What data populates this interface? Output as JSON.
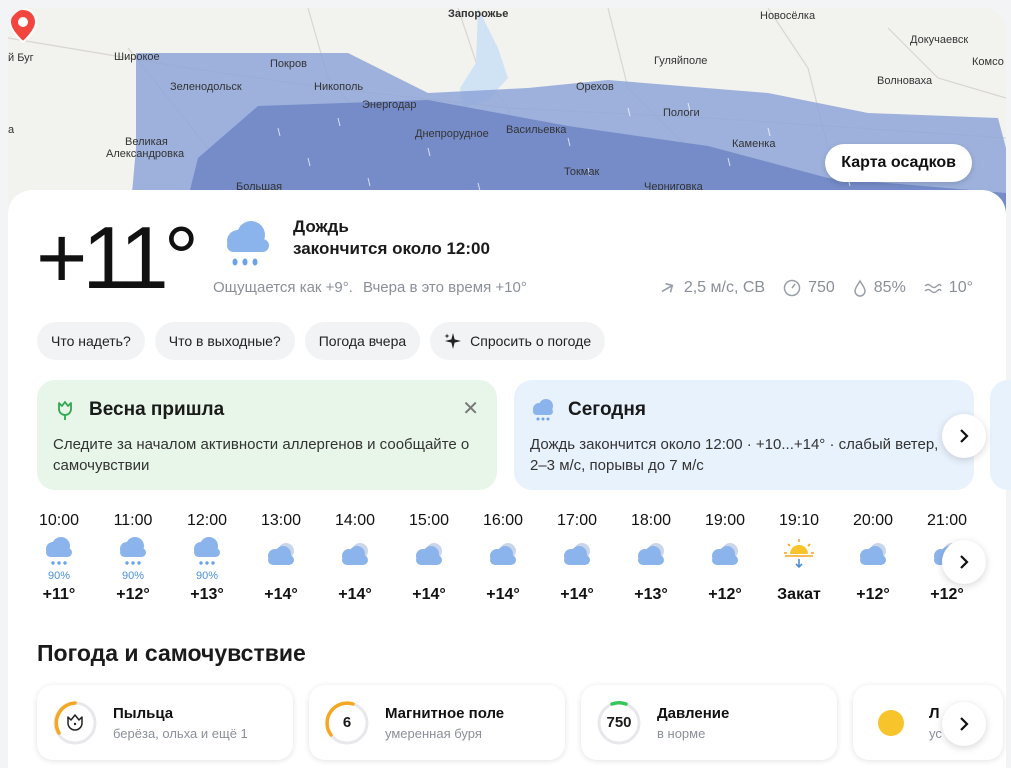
{
  "map": {
    "labels": [
      {
        "id": "zaporozhye",
        "text": "Запорожье"
      },
      {
        "id": "novoselka",
        "text": "Новосёлка"
      },
      {
        "id": "dokuchaevsk",
        "text": "Докучаевск"
      },
      {
        "id": "bug",
        "text": "й Буг"
      },
      {
        "id": "shirokoe",
        "text": "Широкое"
      },
      {
        "id": "pokrov",
        "text": "Покров"
      },
      {
        "id": "gulyaypole",
        "text": "Гуляйполе"
      },
      {
        "id": "komso",
        "text": "Комсо"
      },
      {
        "id": "zelenodolsk",
        "text": "Зеленодольск"
      },
      {
        "id": "nikopol",
        "text": "Никополь"
      },
      {
        "id": "orekhov",
        "text": "Орехов"
      },
      {
        "id": "volnovakha",
        "text": "Волноваха"
      },
      {
        "id": "energodar",
        "text": "Энергодар"
      },
      {
        "id": "pologi",
        "text": "Пологи"
      },
      {
        "id": "dneprorudnoe",
        "text": "Днепрорудное"
      },
      {
        "id": "vasilyevka",
        "text": "Васильевка"
      },
      {
        "id": "velikaya",
        "text": "Великая"
      },
      {
        "id": "aleksandrovka",
        "text": "Александровка"
      },
      {
        "id": "kamenka",
        "text": "Каменка"
      },
      {
        "id": "tokmak",
        "text": "Токмак"
      },
      {
        "id": "bolshaya",
        "text": "Большая"
      },
      {
        "id": "chernigovka",
        "text": "Черниговка"
      },
      {
        "id": "a",
        "text": "а"
      }
    ],
    "precip_button": "Карта осадков"
  },
  "current": {
    "temperature": "+11°",
    "condition": "Дождь",
    "condition_sub": "закончится около 12:00",
    "feels_like": "Ощущается как +9°.",
    "yesterday": "Вчера в это время +10°",
    "wind": "2,5 м/с, СВ",
    "pressure": "750",
    "humidity": "85%",
    "water": "10°"
  },
  "chips": [
    {
      "label": "Что надеть?"
    },
    {
      "label": "Что в выходные?"
    },
    {
      "label": "Погода вчера"
    },
    {
      "label": "Спросить о погоде"
    }
  ],
  "spring_card": {
    "title": "Весна пришла",
    "body": "Следите за началом активности аллергенов и сообщайте о самочувствии",
    "close": "✕"
  },
  "today_card": {
    "title": "Сегодня",
    "body": "Дождь закончится около 12:00 · +10...+14° · слабый ветер, 2–3 м/с, порывы до 7 м/с"
  },
  "hourly": [
    {
      "time": "10:00",
      "icon": "rain",
      "prob": "90%",
      "temp": "+11°"
    },
    {
      "time": "11:00",
      "icon": "rain",
      "prob": "90%",
      "temp": "+12°"
    },
    {
      "time": "12:00",
      "icon": "rain",
      "prob": "90%",
      "temp": "+13°"
    },
    {
      "time": "13:00",
      "icon": "cloudy",
      "prob": "",
      "temp": "+14°"
    },
    {
      "time": "14:00",
      "icon": "cloudy",
      "prob": "",
      "temp": "+14°"
    },
    {
      "time": "15:00",
      "icon": "cloudy",
      "prob": "",
      "temp": "+14°"
    },
    {
      "time": "16:00",
      "icon": "cloudy",
      "prob": "",
      "temp": "+14°"
    },
    {
      "time": "17:00",
      "icon": "cloudy",
      "prob": "",
      "temp": "+14°"
    },
    {
      "time": "18:00",
      "icon": "cloudy",
      "prob": "",
      "temp": "+13°"
    },
    {
      "time": "19:00",
      "icon": "cloudy",
      "prob": "",
      "temp": "+12°"
    },
    {
      "time": "19:10",
      "icon": "sunset",
      "prob": "",
      "temp": "Закат"
    },
    {
      "time": "20:00",
      "icon": "cloudy",
      "prob": "",
      "temp": "+12°"
    },
    {
      "time": "21:00",
      "icon": "cloudy",
      "prob": "",
      "temp": "+12°"
    }
  ],
  "wellbeing": {
    "title": "Погода и самочувствие",
    "tiles": [
      {
        "name": "Пыльца",
        "desc": "берёза, ольха и ещё 1",
        "value": "",
        "color": "#f5a623",
        "icon": "flower-icon"
      },
      {
        "name": "Магнитное поле",
        "desc": "умеренная буря",
        "value": "6",
        "color": "#f5a623",
        "icon": "magnet-gauge"
      },
      {
        "name": "Давление",
        "desc": "в норме",
        "value": "750",
        "color": "#34c759",
        "icon": "pressure-gauge"
      },
      {
        "name": "Л",
        "desc": "ус",
        "value": "",
        "color": "#f7c52b",
        "icon": "sun-icon"
      }
    ]
  },
  "colors": {
    "rain_light": "#8ea6d8",
    "rain_dark": "#6f86c6",
    "rain_icon": "#8bb4ec",
    "pin": "#f2453d",
    "spring_bg": "#e7f6e8",
    "today_bg": "#e8f2fd"
  }
}
